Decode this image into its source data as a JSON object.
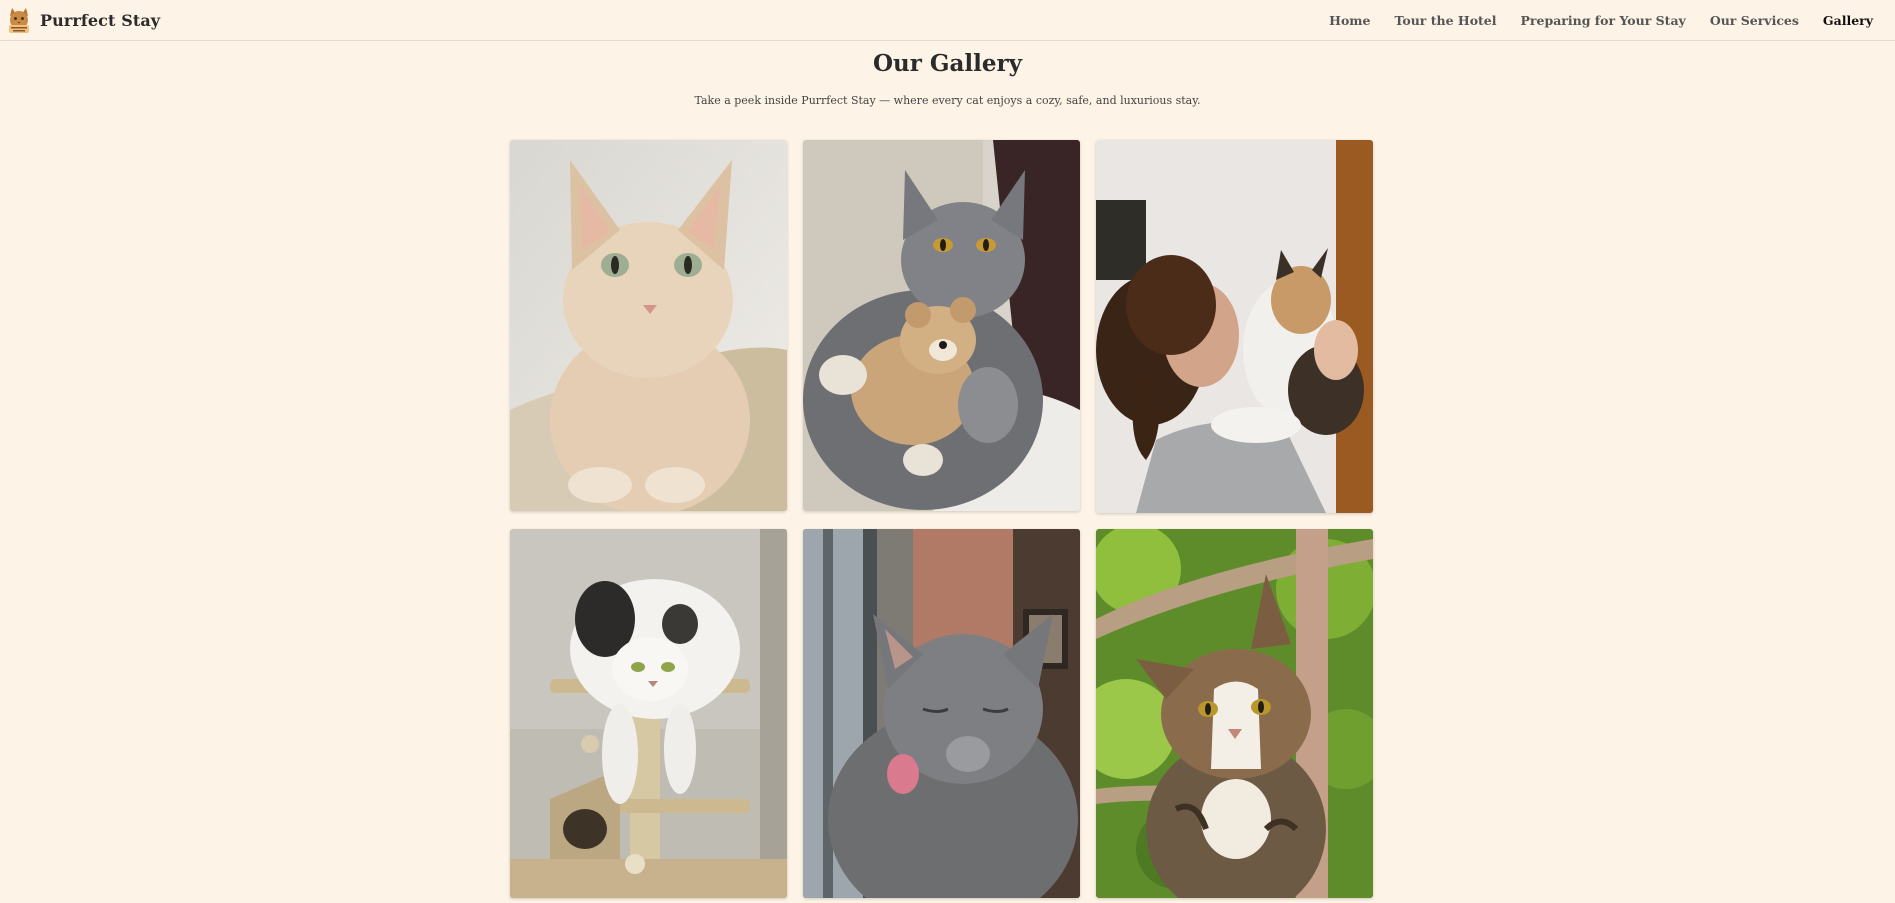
{
  "brand": {
    "name": "Purrfect Stay",
    "logo_icon": "cat-logo-icon"
  },
  "nav": {
    "items": [
      {
        "label": "Home",
        "active": false
      },
      {
        "label": "Tour the Hotel",
        "active": false
      },
      {
        "label": "Preparing for Your Stay",
        "active": false
      },
      {
        "label": "Our Services",
        "active": false
      },
      {
        "label": "Gallery",
        "active": true
      }
    ]
  },
  "page": {
    "title": "Our Gallery",
    "subtitle": "Take a peek inside Purrfect Stay — where every cat enjoys a cozy, safe, and luxurious stay."
  },
  "gallery": {
    "photos": [
      {
        "subject": "cream tabby cat lying on knit blanket"
      },
      {
        "subject": "grey cat hugging teddy bear"
      },
      {
        "subject": "woman kissing calico cat"
      },
      {
        "subject": "white and black fluffy cat on cat tree"
      },
      {
        "subject": "grey cat licking by window"
      },
      {
        "subject": "tabby cat in tree"
      }
    ]
  },
  "colors": {
    "background": "#fdf3e6",
    "text": "#2b2b2b",
    "nav_text": "#555555",
    "nav_active": "#111111"
  }
}
